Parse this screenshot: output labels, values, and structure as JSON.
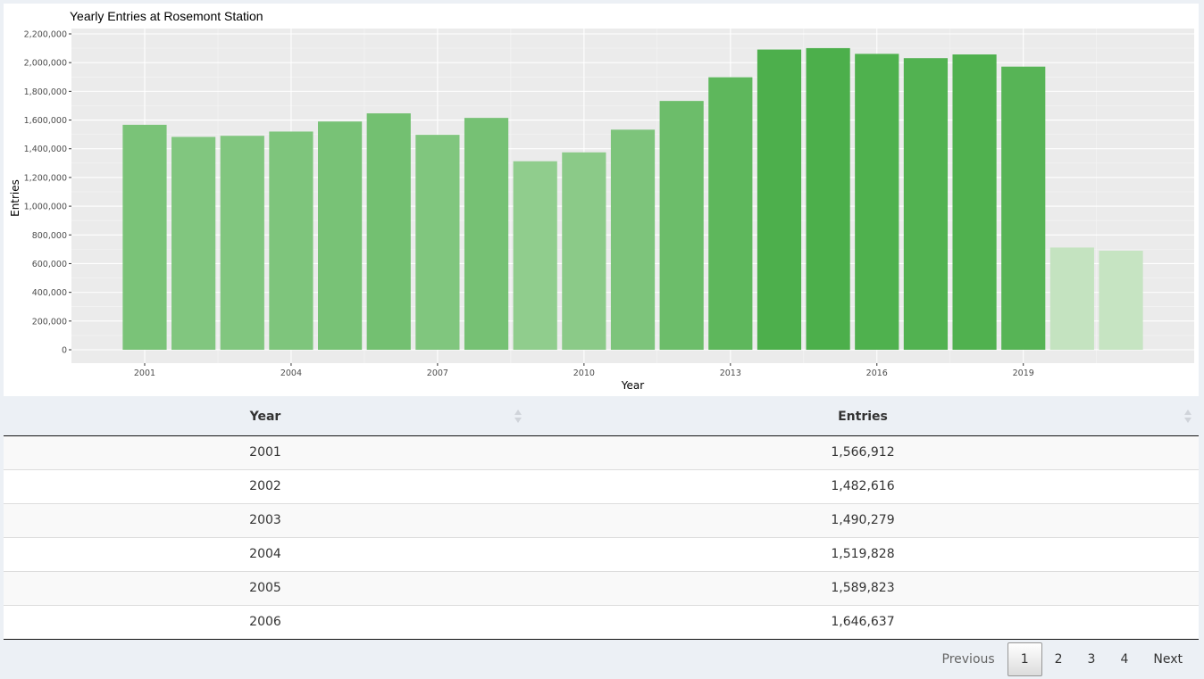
{
  "chart_data": {
    "type": "bar",
    "title": "Yearly Entries at Rosemont Station",
    "xlabel": "Year",
    "ylabel": "Entries",
    "x": [
      2001,
      2002,
      2003,
      2004,
      2005,
      2006,
      2007,
      2008,
      2009,
      2010,
      2011,
      2012,
      2013,
      2014,
      2015,
      2016,
      2017,
      2018,
      2019,
      2020,
      2021
    ],
    "values": [
      1566912,
      1482616,
      1490279,
      1519828,
      1589823,
      1646637,
      1497000,
      1615000,
      1313000,
      1375000,
      1533000,
      1733000,
      1898000,
      2091000,
      2101000,
      2061000,
      2031000,
      2057000,
      1972000,
      712000,
      690000
    ],
    "xticks": [
      2001,
      2004,
      2007,
      2010,
      2013,
      2016,
      2019
    ],
    "yticks": [
      "0",
      "200,000",
      "400,000",
      "600,000",
      "800,000",
      "1,000,000",
      "1,200,000",
      "1,400,000",
      "1,600,000",
      "1,800,000",
      "2,000,000",
      "2,200,000"
    ],
    "ylim": [
      0,
      2200000
    ],
    "xlim": [
      1999.5,
      2022.5
    ],
    "grid": true,
    "color_low": "#c6e4c2",
    "color_high": "#4caf4b",
    "panel_bg": "#ebebeb"
  },
  "table": {
    "columns": [
      "Year",
      "Entries"
    ],
    "rows": [
      {
        "year": "2001",
        "entries": "1,566,912"
      },
      {
        "year": "2002",
        "entries": "1,482,616"
      },
      {
        "year": "2003",
        "entries": "1,490,279"
      },
      {
        "year": "2004",
        "entries": "1,519,828"
      },
      {
        "year": "2005",
        "entries": "1,589,823"
      },
      {
        "year": "2006",
        "entries": "1,646,637"
      }
    ]
  },
  "pagination": {
    "previous": "Previous",
    "pages": [
      "1",
      "2",
      "3",
      "4"
    ],
    "current": "1",
    "next": "Next"
  }
}
